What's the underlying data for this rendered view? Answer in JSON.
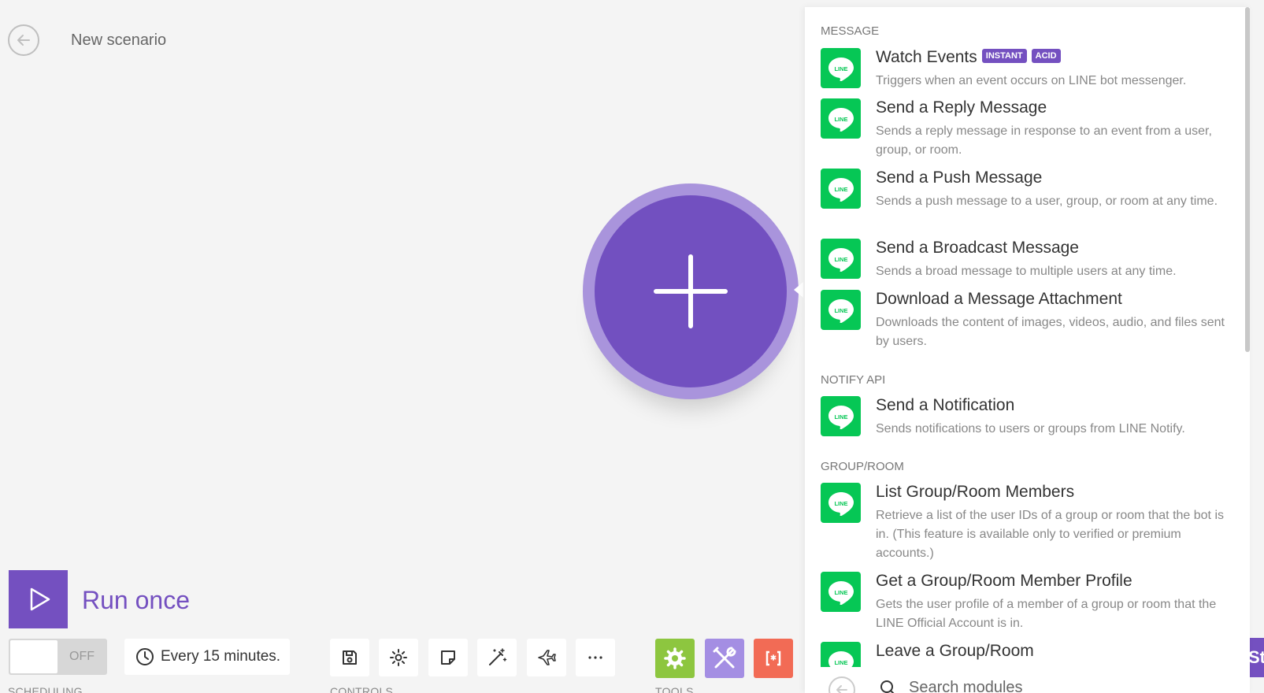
{
  "header": {
    "title": "New scenario"
  },
  "run": {
    "label": "Run once"
  },
  "scheduling": {
    "toggle_label": "OFF",
    "interval": "Every 15 minutes.",
    "section": "SCHEDULING"
  },
  "controls": {
    "section": "CONTROLS"
  },
  "tools": {
    "section": "TOOLS"
  },
  "edge_button": {
    "label": "Sta"
  },
  "colors": {
    "accent": "#7450c0",
    "line_green": "#06c755",
    "tools_green": "#8dc63f",
    "tools_purple": "#a48ee3",
    "tools_red": "#f26b55"
  },
  "panel": {
    "groups": [
      {
        "title": "MESSAGE"
      },
      {
        "title": "NOTIFY API"
      },
      {
        "title": "GROUP/ROOM"
      }
    ],
    "items": [
      {
        "title": "Watch Events",
        "badges": [
          "INSTANT",
          "ACID"
        ],
        "desc": "Triggers when an event occurs on LINE bot messenger."
      },
      {
        "title": "Send a Reply Message",
        "desc": "Sends a reply message in response to an event from a user, group, or room."
      },
      {
        "title": "Send a Push Message",
        "desc": "Sends a push message to a user, group, or room at any time."
      },
      {
        "title": "Send a Broadcast Message",
        "desc": "Sends a broad message to multiple users at any time."
      },
      {
        "title": "Download a Message Attachment",
        "desc": "Downloads the content of images, videos, audio, and files sent by users."
      },
      {
        "title": "Send a Notification",
        "desc": "Sends notifications to users or groups from LINE Notify."
      },
      {
        "title": "List Group/Room Members",
        "desc": "Retrieve a list of the user IDs of a group or room that the bot is in. (This feature is available only to verified or premium accounts.)"
      },
      {
        "title": "Get a Group/Room Member Profile",
        "desc": "Gets the user profile of a member of a group or room that the LINE Official Account is in."
      },
      {
        "title": "Leave a Group/Room",
        "desc": ""
      }
    ],
    "icon_text": "LINE",
    "search": {
      "placeholder": "Search modules"
    }
  }
}
